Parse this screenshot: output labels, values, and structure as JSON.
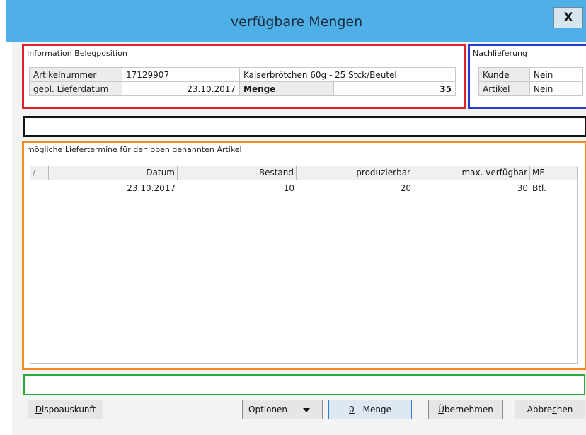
{
  "window": {
    "title": "verfügbare Mengen",
    "close_glyph": "X"
  },
  "belegposition": {
    "label": "Information Belegposition",
    "artikelnummer_label": "Artikelnummer",
    "artikelnummer_value": "17129907",
    "artikel_bezeichnung": "Kaiserbrötchen 60g - 25 Stck/Beutel",
    "lieferdatum_label": "gepl. Lieferdatum",
    "lieferdatum_value": "23.10.2017",
    "menge_label": "Menge",
    "menge_value": "35"
  },
  "nachlieferung": {
    "label": "Nachlieferung",
    "kunde_label": "Kunde",
    "kunde_value": "Nein",
    "artikel_label": "Artikel",
    "artikel_value": "Nein"
  },
  "liefertermine": {
    "label": "mögliche Liefertermine für den oben genannten Artikel",
    "columns": {
      "sort": "/",
      "datum": "Datum",
      "bestand": "Bestand",
      "produzierbar": "produzierbar",
      "max_verfuegbar": "max. verfügbar",
      "me": "ME"
    },
    "rows": [
      {
        "datum": "23.10.2017",
        "bestand": "10",
        "produzierbar": "20",
        "max_verfuegbar": "30",
        "me": "Btl."
      }
    ]
  },
  "buttons": {
    "dispo_prefix": "D",
    "dispo_rest": "ispoauskunft",
    "optionen": "Optionen",
    "null_menge_prefix": "0",
    "null_menge_rest": " - Menge",
    "uebernehmen_prefix": "Ü",
    "uebernehmen_rest": "bernehmen",
    "abbrechen_a": "Abbre",
    "abbrechen_u": "c",
    "abbrechen_b": "hen"
  },
  "icons": {
    "close": "close-icon",
    "dropdown": "chevron-down-icon"
  },
  "colors": {
    "title_bar": "#4fb0e8",
    "frame_red": "#e0202a",
    "frame_blue": "#2a3ad0",
    "frame_orange": "#f28a1e",
    "frame_green": "#2aa83c"
  }
}
